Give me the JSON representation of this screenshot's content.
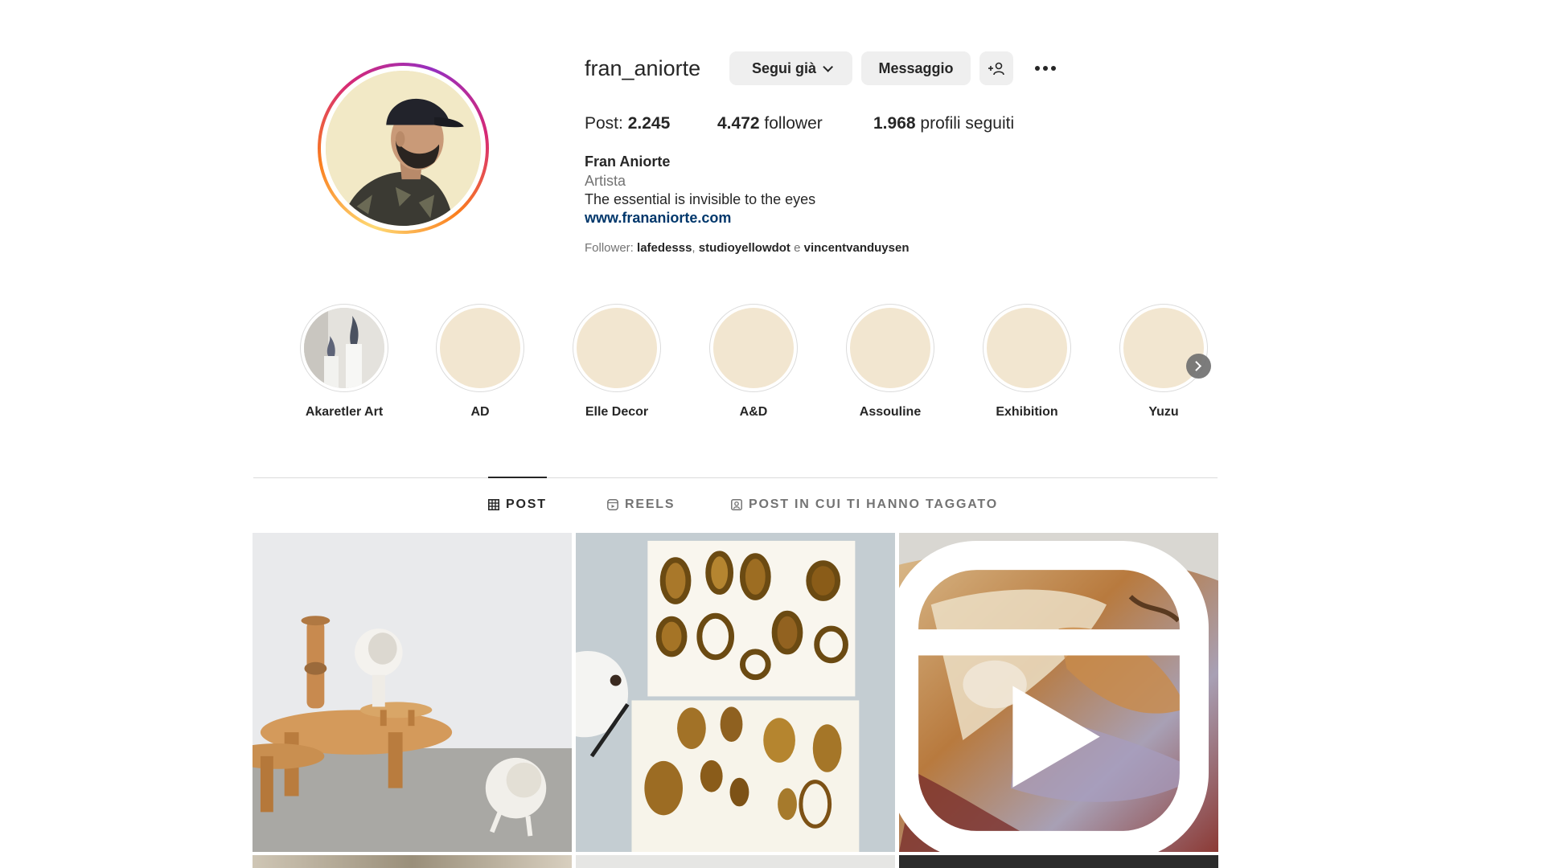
{
  "profile": {
    "username": "fran_aniorte",
    "follow_button": "Segui già",
    "message_button": "Messaggio",
    "add_user_icon": "+👤",
    "stats": {
      "posts_label": "Post: ",
      "posts_value": "2.245",
      "followers_value": "4.472",
      "followers_label": " follower",
      "following_value": "1.968",
      "following_label": " profili seguiti"
    },
    "bio": {
      "name": "Fran Aniorte",
      "category": "Artista",
      "text": "The essential is invisible to the eyes",
      "link": "www.frananiorte.com"
    },
    "followed_by": {
      "prefix": "Follower: ",
      "users": [
        "lafedesss",
        "studioyellowdot",
        "vincentvanduysen"
      ],
      "sep": ", ",
      "and": " e "
    }
  },
  "highlights": [
    {
      "label": "Akaretler Art"
    },
    {
      "label": "AD"
    },
    {
      "label": "Elle Decor"
    },
    {
      "label": "A&D"
    },
    {
      "label": "Assouline"
    },
    {
      "label": "Exhibition"
    },
    {
      "label": "Yuzu"
    }
  ],
  "tabs": [
    {
      "label": "POST",
      "icon": "grid-icon",
      "active": true
    },
    {
      "label": "REELS",
      "icon": "reels-icon",
      "active": false
    },
    {
      "label": "POST IN CUI TI HANNO TAGGATO",
      "icon": "tagged-icon",
      "active": false
    }
  ],
  "colors": {
    "link": "#00376b",
    "button_bg": "#efefef",
    "highlight_bg": "#f2e6d0",
    "muted_text": "#737373"
  }
}
